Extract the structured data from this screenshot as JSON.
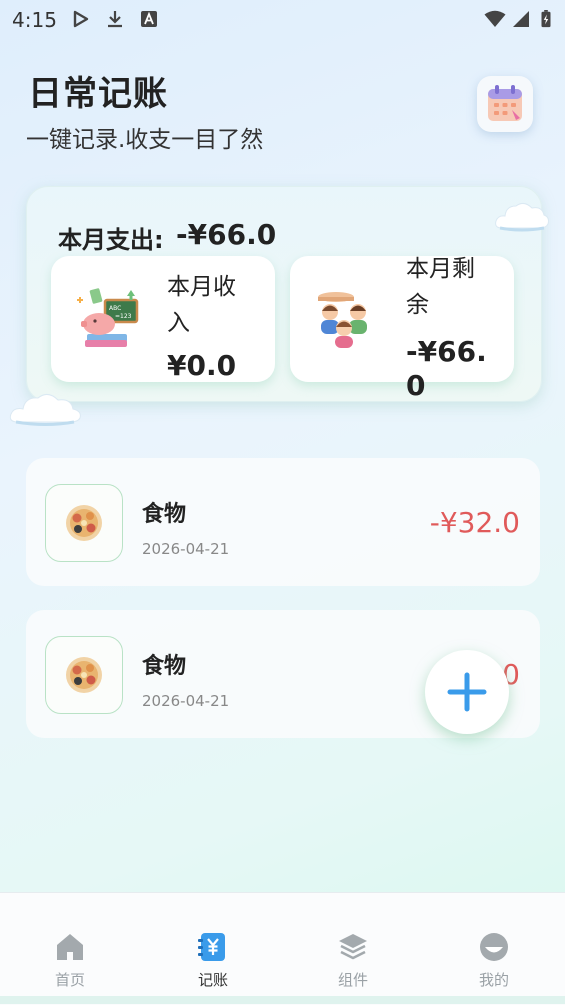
{
  "status_bar": {
    "time": "4:15",
    "left_icons": [
      "play-icon",
      "download-icon",
      "text-a-icon"
    ],
    "right_icons": [
      "wifi-icon",
      "signal-icon",
      "battery-charging-icon"
    ]
  },
  "header": {
    "title": "日常记账",
    "subtitle": "一键记录.收支一目了然",
    "calendar_icon": "calendar-icon"
  },
  "summary": {
    "expense_label": "本月支出:",
    "expense_value": "-¥66.0",
    "income": {
      "label_line1": "本月收",
      "label_line2": "入",
      "value": "¥0.0",
      "icon": "money-piggy-icon"
    },
    "remaining": {
      "label_line1": "本月剩",
      "label_line2": "余",
      "value_line1": "-¥66.",
      "value_line2": "0",
      "icon": "family-icon"
    }
  },
  "records": [
    {
      "icon": "food-plate-icon",
      "category": "食物",
      "date": "2026-04-21",
      "amount": "-¥32.0"
    },
    {
      "icon": "food-plate-icon",
      "category": "食物",
      "date": "2026-04-21",
      "amount": "0"
    }
  ],
  "fab": {
    "icon": "plus-icon"
  },
  "tabs": [
    {
      "label": "首页",
      "icon": "home-icon",
      "active": false
    },
    {
      "label": "记账",
      "icon": "yen-note-icon",
      "active": true
    },
    {
      "label": "组件",
      "icon": "layers-icon",
      "active": false
    },
    {
      "label": "我的",
      "icon": "profile-icon",
      "active": false
    }
  ],
  "colors": {
    "expense_red": "#e05a5a",
    "accent_blue": "#3a9bea",
    "mint_border": "#b9e2c6"
  }
}
